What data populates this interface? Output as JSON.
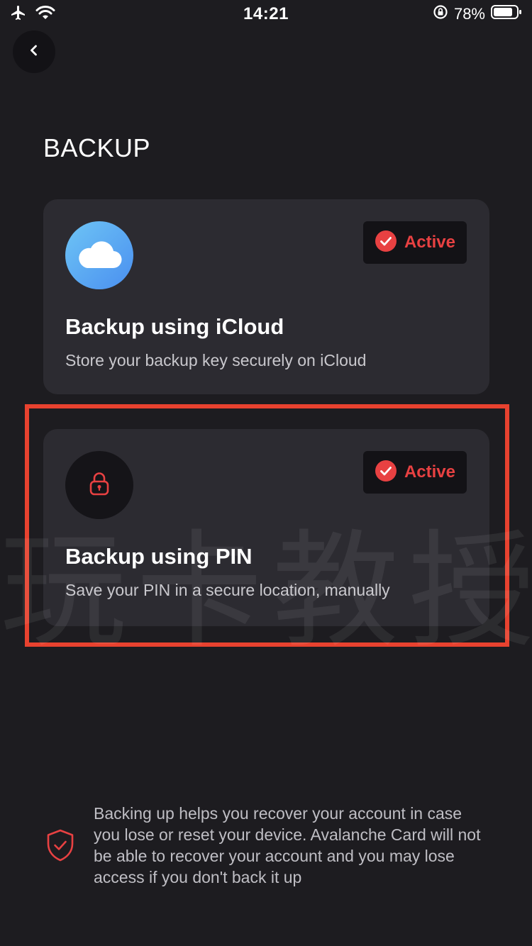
{
  "status_bar": {
    "time": "14:21",
    "battery": "78%",
    "icons": [
      "airplane-icon",
      "wifi-icon",
      "rotation-lock-icon",
      "battery-icon"
    ]
  },
  "header": {
    "back_icon": "chevron-left-icon",
    "title": "BACKUP"
  },
  "options": [
    {
      "title": "Backup using iCloud",
      "subtitle": "Store your backup key securely on iCloud",
      "badge": "Active",
      "icon": "cloud-icon"
    },
    {
      "title": "Backup using PIN",
      "subtitle": "Save your PIN in a secure location, manually",
      "badge": "Active",
      "icon": "lock-icon"
    }
  ],
  "footer": {
    "icon": "shield-check-icon",
    "note": "Backing up helps you recover your account in case you lose or reset your device. Avalanche Card will not be able to recover your account and you may lose access if you don't back it up"
  },
  "watermark": "玩卡教授",
  "colors": {
    "background": "#1d1c20",
    "card": "#2c2b31",
    "accent_red": "#e84142",
    "highlight": "#e8422f",
    "cloud_gradient_start": "#6ec5f5",
    "cloud_gradient_end": "#4a8ff0"
  }
}
